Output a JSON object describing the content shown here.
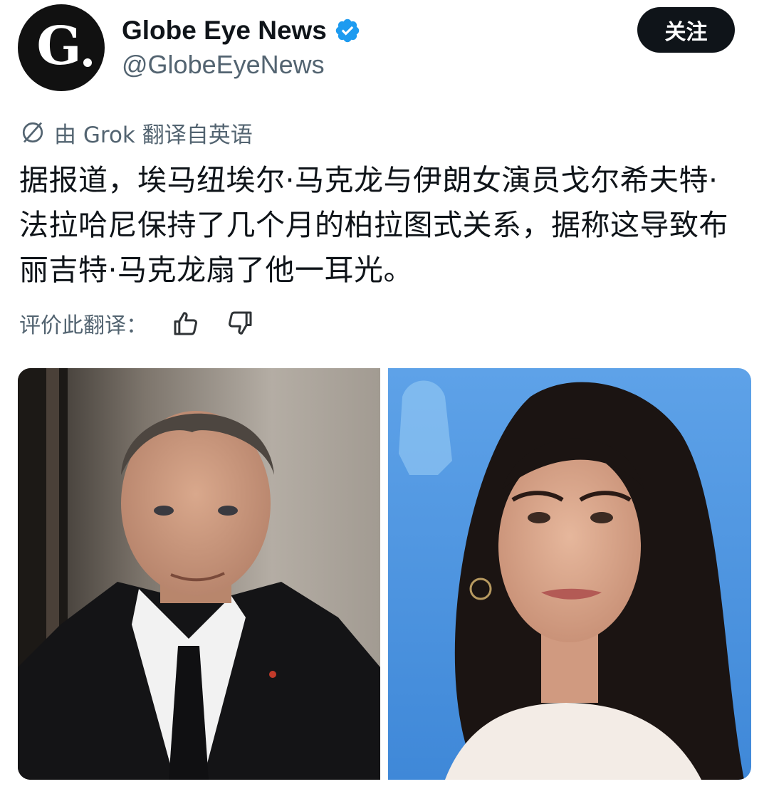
{
  "account": {
    "display_name": "Globe Eye News",
    "handle": "@GlobeEyeNews",
    "avatar_letter": "G",
    "verified": true
  },
  "follow_button": {
    "label": "关注"
  },
  "translation": {
    "note": "由 Grok 翻译自英语",
    "rate_label": "评价此翻译："
  },
  "tweet": {
    "text": "据报道，埃马纽埃尔·马克龙与伊朗女演员戈尔希夫特·法拉哈尼保持了几个月的柏拉图式关系，据称这导致布丽吉特·马克龙扇了他一耳光。"
  },
  "icons": {
    "verified": "verified-badge-icon",
    "translate": "globe-slash-icon",
    "like": "thumbs-up-icon",
    "dislike": "thumbs-down-icon"
  },
  "colors": {
    "text_primary": "#0f1419",
    "text_secondary": "#536471",
    "verified": "#1d9bf0",
    "button_bg": "#0f1419"
  },
  "media": [
    {
      "subject": "man-in-dark-suit-photo"
    },
    {
      "subject": "woman-with-long-dark-hair-photo"
    }
  ]
}
